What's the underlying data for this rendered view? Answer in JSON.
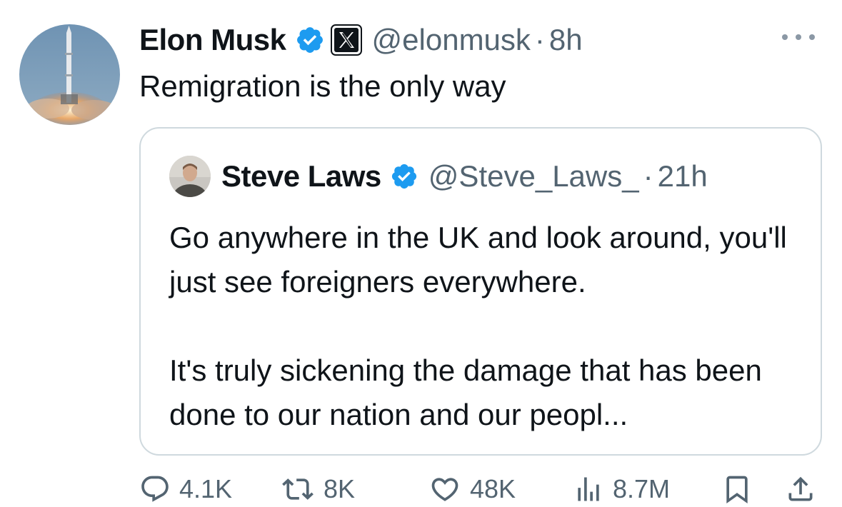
{
  "author": {
    "name": "Elon Musk",
    "handle": "@elonmusk",
    "separator": "·",
    "time": "8h",
    "verified": true,
    "affiliation_badge": "x-logo-icon"
  },
  "tweet": {
    "text": "Remigration is the only way"
  },
  "quoted": {
    "author": {
      "name": "Steve Laws",
      "handle": "@Steve_Laws_",
      "separator": "·",
      "time": "21h",
      "verified": true
    },
    "paragraphs": [
      "Go anywhere in the UK and look around, you'll just see foreigners everywhere.",
      "It's truly sickening the damage that has been done to our nation and our peopl..."
    ]
  },
  "actions": {
    "replies": "4.1K",
    "reposts": "8K",
    "likes": "48K",
    "views": "8.7M"
  },
  "icons": {
    "reply": "reply-icon",
    "repost": "repost-icon",
    "like": "heart-icon",
    "views": "views-icon",
    "bookmark": "bookmark-icon",
    "share": "share-icon",
    "more": "more-icon"
  },
  "colors": {
    "verified_blue": "#1d9bf0",
    "text": "#0f1419",
    "secondary": "#536471",
    "border": "#cfd9de"
  }
}
